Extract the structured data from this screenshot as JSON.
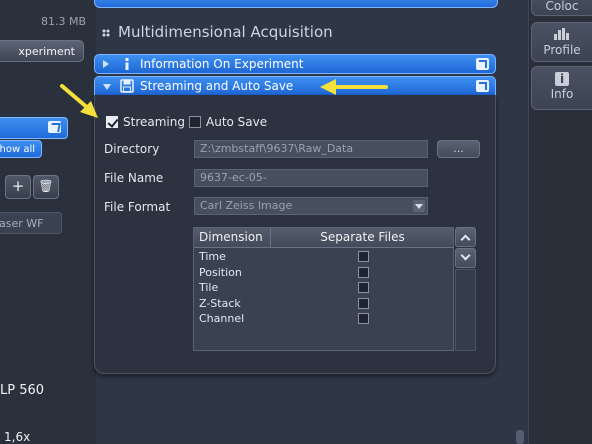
{
  "left_panel": {
    "memory": "81.3 MB",
    "experiment_button": "xperiment",
    "show_all": "how all",
    "add": "+",
    "delete": "🗑",
    "laser_field": "aser WF",
    "lp_label": "LP 560",
    "mag_label": "1,6x"
  },
  "right_panel": {
    "tabs": [
      {
        "label": "Coloc"
      },
      {
        "label": "Profile",
        "icon": "histogram-icon"
      },
      {
        "label": "Info",
        "icon": "info-icon"
      }
    ]
  },
  "section": {
    "title": "Multidimensional Acquisition"
  },
  "bars": {
    "info_experiment": "Information On Experiment",
    "streaming": "Streaming and Auto Save"
  },
  "streaming": {
    "streaming_label": "Streaming",
    "streaming_checked": true,
    "autosave_label": "Auto Save",
    "autosave_checked": false,
    "directory_label": "Directory",
    "directory_value": "Z:\\zmbstaff\\9637\\Raw_Data",
    "browse_label": "...",
    "filename_label": "File Name",
    "filename_value": "9637-ec-05-",
    "fileformat_label": "File Format",
    "fileformat_value": "Carl Zeiss Image"
  },
  "table": {
    "col_dimension": "Dimension",
    "col_separate": "Separate Files",
    "rows": [
      "Time",
      "Position",
      "Tile",
      "Z-Stack",
      "Channel"
    ]
  },
  "colors": {
    "accent_blue": "#1f6ad8",
    "annotation_yellow": "#f4e03a",
    "panel_bg": "#2c3240"
  }
}
